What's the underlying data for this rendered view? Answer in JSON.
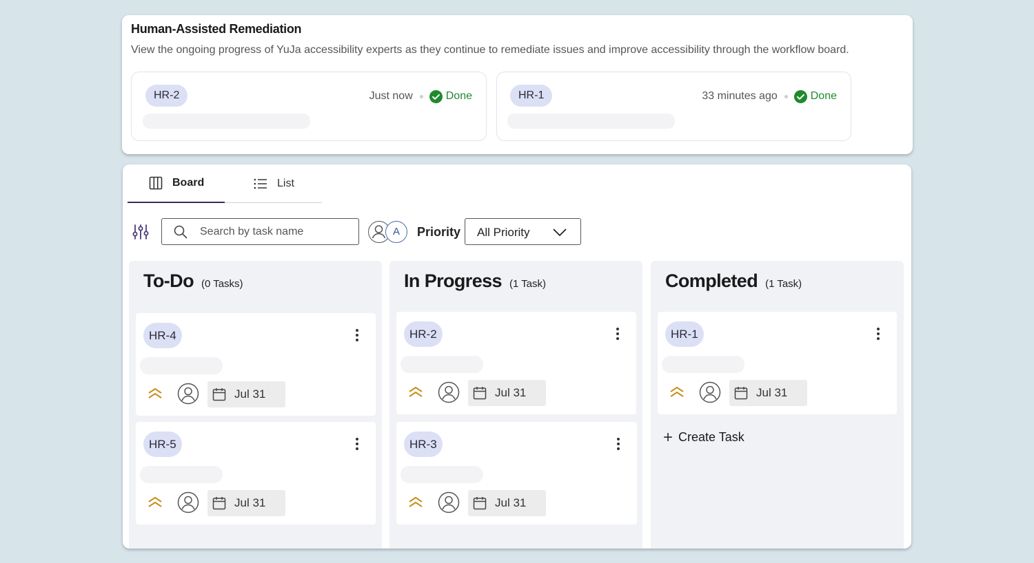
{
  "remediation": {
    "title": "Human-Assisted Remediation",
    "description": "View the ongoing progress of YuJa accessibility experts as they continue to remediate issues and improve accessibility through the workflow board.",
    "updates": [
      {
        "id": "HR-2",
        "time": "Just now",
        "status": "Done"
      },
      {
        "id": "HR-1",
        "time": "33 minutes ago",
        "status": "Done"
      }
    ]
  },
  "tabs": {
    "board": "Board",
    "list": "List"
  },
  "filters": {
    "search_placeholder": "Search by task name",
    "avatar_initial": "A",
    "priority_label": "Priority",
    "priority_value": "All Priority"
  },
  "columns": [
    {
      "title": "To-Do",
      "count": "(0 Tasks)",
      "tasks": [
        {
          "id": "HR-4",
          "date": "Jul 31"
        },
        {
          "id": "HR-5",
          "date": "Jul 31"
        }
      ]
    },
    {
      "title": "In Progress",
      "count": "(1 Task)",
      "tasks": [
        {
          "id": "HR-2",
          "date": "Jul 31"
        },
        {
          "id": "HR-3",
          "date": "Jul 31"
        }
      ]
    },
    {
      "title": "Completed",
      "count": "(1 Task)",
      "tasks": [
        {
          "id": "HR-1",
          "date": "Jul 31"
        }
      ],
      "create_task": "Create Task"
    }
  ],
  "colors": {
    "accent": "#3d2a55",
    "done": "#1f8a2e",
    "priority": "#c8921e",
    "chip": "#dce0f5"
  },
  "icons": {
    "tab_board": "columns-icon",
    "tab_list": "list-icon",
    "filter": "sliders-icon",
    "search": "search-icon",
    "priority": "chevrons-up-icon",
    "assignee": "user-circle-icon",
    "date": "calendar-icon",
    "menu": "kebab-icon"
  }
}
